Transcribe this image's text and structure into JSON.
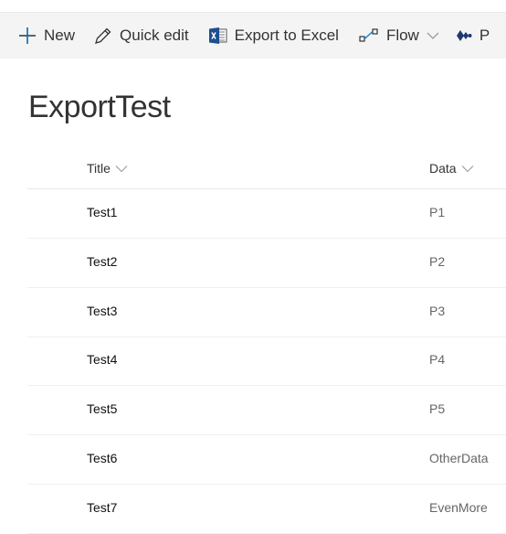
{
  "toolbar": {
    "items": [
      {
        "label": "New",
        "icon": "plus-icon"
      },
      {
        "label": "Quick edit",
        "icon": "pencil-icon"
      },
      {
        "label": "Export to Excel",
        "icon": "excel-icon"
      },
      {
        "label": "Flow",
        "icon": "flow-icon"
      },
      {
        "label": "P",
        "icon": "powerapps-icon"
      }
    ],
    "accent": "#0078d4",
    "excel_color": "#1d4f91"
  },
  "list": {
    "title": "ExportTest",
    "columns": [
      "Title",
      "Data"
    ],
    "rows": [
      [
        "Test1",
        "P1"
      ],
      [
        "Test2",
        "P2"
      ],
      [
        "Test3",
        "P3"
      ],
      [
        "Test4",
        "P4"
      ],
      [
        "Test5",
        "P5"
      ],
      [
        "Test6",
        "OtherData"
      ],
      [
        "Test7",
        "EvenMore"
      ]
    ]
  }
}
